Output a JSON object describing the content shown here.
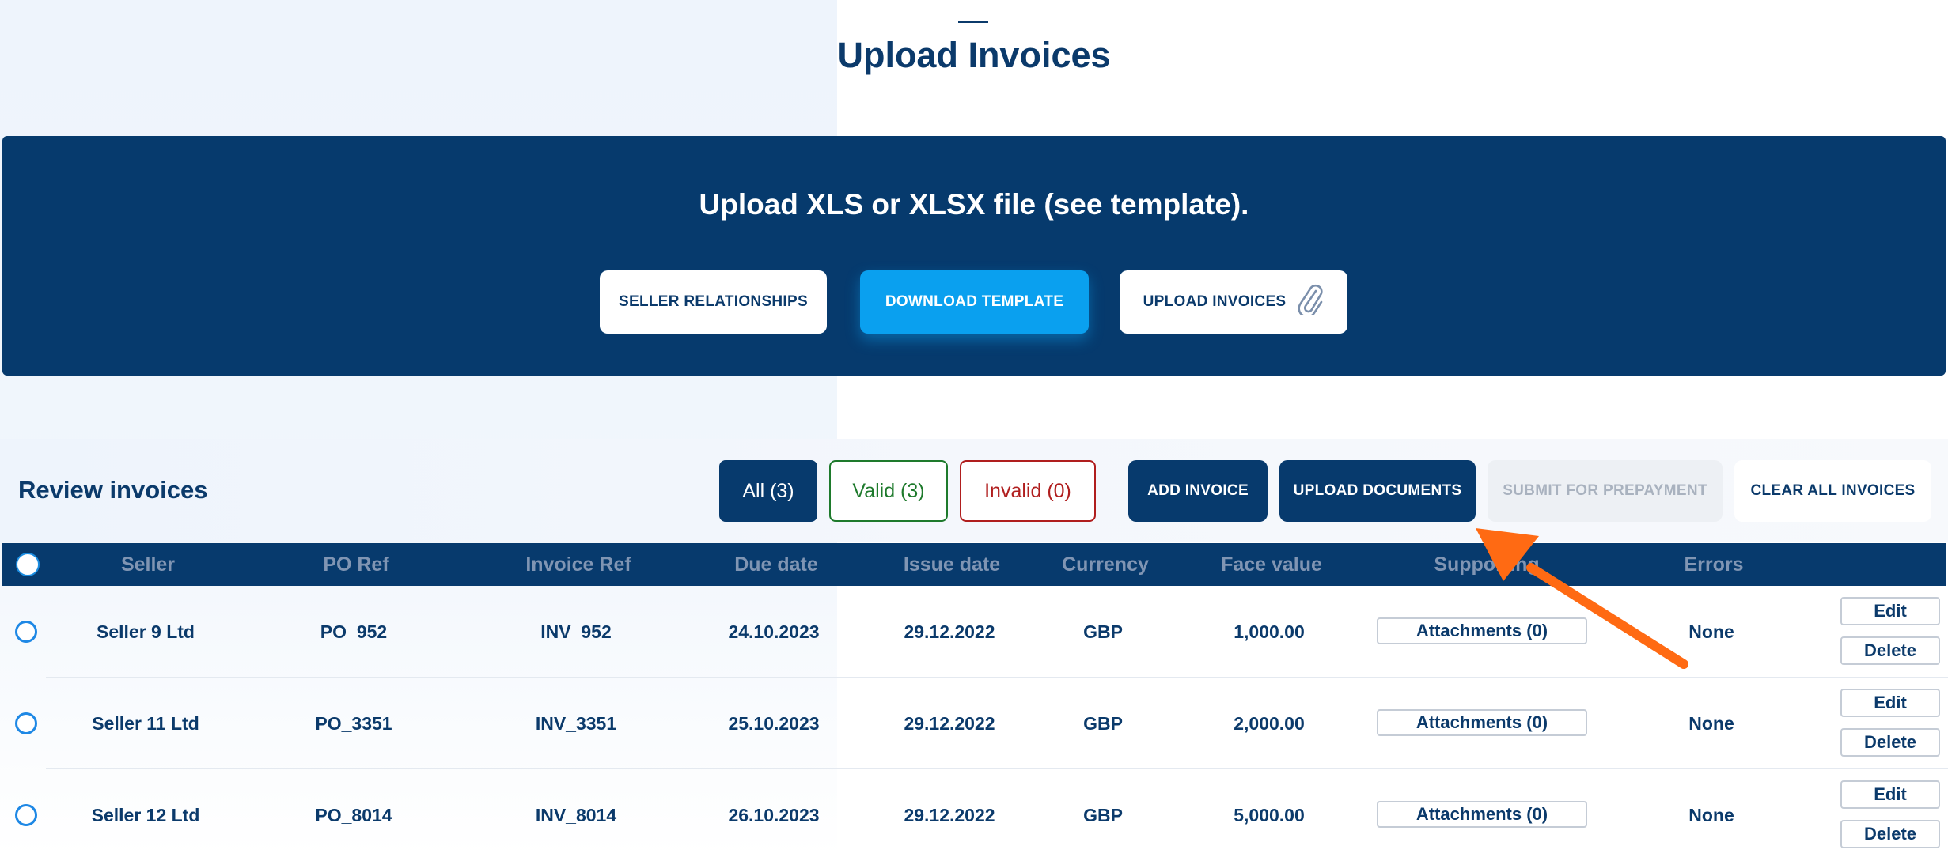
{
  "page": {
    "title": "Upload Invoices"
  },
  "banner": {
    "text": "Upload XLS or XLSX file (see template).",
    "seller_relationships": "SELLER RELATIONSHIPS",
    "download_template": "DOWNLOAD TEMPLATE",
    "upload_invoices": "UPLOAD INVOICES"
  },
  "review": {
    "title": "Review invoices",
    "filters": {
      "all": "All (3)",
      "valid": "Valid (3)",
      "invalid": "Invalid (0)"
    },
    "actions": {
      "add_invoice": "ADD INVOICE",
      "upload_documents": "UPLOAD DOCUMENTS",
      "submit_prepayment": "SUBMIT FOR PREPAYMENT",
      "clear_all": "CLEAR ALL INVOICES"
    }
  },
  "table": {
    "headers": [
      "Seller",
      "PO Ref",
      "Invoice Ref",
      "Due date",
      "Issue date",
      "Currency",
      "Face value",
      "Supporting",
      "Errors"
    ],
    "rows": [
      {
        "seller": "Seller 9 Ltd",
        "po_ref": "PO_952",
        "invoice_ref": "INV_952",
        "due_date": "24.10.2023",
        "issue_date": "29.12.2022",
        "currency": "GBP",
        "face_value": "1,000.00",
        "attachments": "Attachments (0)",
        "errors": "None",
        "edit": "Edit",
        "delete": "Delete"
      },
      {
        "seller": "Seller 11 Ltd",
        "po_ref": "PO_3351",
        "invoice_ref": "INV_3351",
        "due_date": "25.10.2023",
        "issue_date": "29.12.2022",
        "currency": "GBP",
        "face_value": "2,000.00",
        "attachments": "Attachments (0)",
        "errors": "None",
        "edit": "Edit",
        "delete": "Delete"
      },
      {
        "seller": "Seller 12 Ltd",
        "po_ref": "PO_8014",
        "invoice_ref": "INV_8014",
        "due_date": "26.10.2023",
        "issue_date": "29.12.2022",
        "currency": "GBP",
        "face_value": "5,000.00",
        "attachments": "Attachments (0)",
        "errors": "None",
        "edit": "Edit",
        "delete": "Delete"
      }
    ]
  },
  "icons": {
    "upload_invoices": "paperclip-icon",
    "annotation": "orange-arrow-icon"
  },
  "colors": {
    "banner": "#063a6d",
    "accent": "#0aa0ef",
    "valid": "#1e7a2c",
    "invalid": "#b01e1e",
    "arrow": "#ff6a13"
  }
}
